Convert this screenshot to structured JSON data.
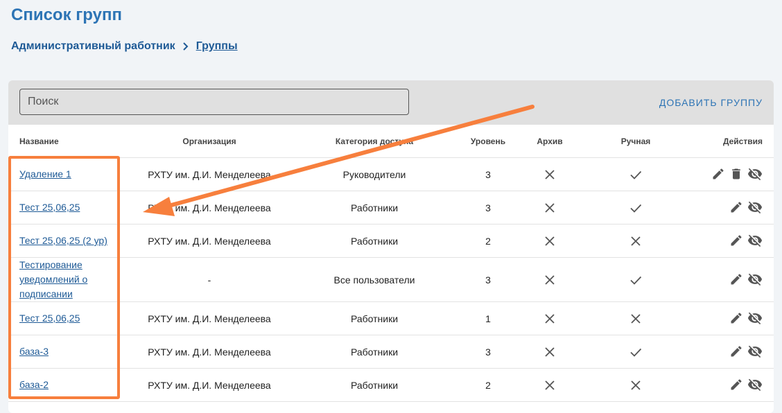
{
  "page": {
    "title": "Список групп"
  },
  "breadcrumb": {
    "parent": "Административный работник",
    "current": "Группы"
  },
  "toolbar": {
    "search_placeholder": "Поиск",
    "add_label": "ДОБАВИТЬ ГРУППУ"
  },
  "table": {
    "columns": {
      "name": "Название",
      "org": "Организация",
      "category": "Категория доступа",
      "level": "Уровень",
      "archive": "Архив",
      "manual": "Ручная",
      "actions": "Действия"
    },
    "rows": [
      {
        "name": "Удаление 1",
        "org": "РХТУ им. Д.И. Менделеева",
        "category": "Руководители",
        "level": "3",
        "archive": "x-icon",
        "manual": "check-icon",
        "actions": [
          "edit-icon",
          "delete-icon",
          "visibility-off-icon"
        ]
      },
      {
        "name": "Тест 25,06,25",
        "org": "РХТУ им. Д.И. Менделеева",
        "category": "Работники",
        "level": "3",
        "archive": "x-icon",
        "manual": "check-icon",
        "actions": [
          "edit-icon",
          "visibility-off-icon"
        ]
      },
      {
        "name": "Тест 25,06,25 (2 ур)",
        "org": "РХТУ им. Д.И. Менделеева",
        "category": "Работники",
        "level": "2",
        "archive": "x-icon",
        "manual": "x-icon",
        "actions": [
          "edit-icon",
          "visibility-off-icon"
        ]
      },
      {
        "name": "Тестирование уведомлений о подписании",
        "org": "-",
        "category": "Все пользователи",
        "level": "3",
        "archive": "x-icon",
        "manual": "check-icon",
        "actions": [
          "edit-icon",
          "visibility-off-icon"
        ]
      },
      {
        "name": "Тест 25,06,25",
        "org": "РХТУ им. Д.И. Менделеева",
        "category": "Работники",
        "level": "1",
        "archive": "x-icon",
        "manual": "x-icon",
        "actions": [
          "edit-icon",
          "visibility-off-icon"
        ]
      },
      {
        "name": "база-3",
        "org": "РХТУ им. Д.И. Менделеева",
        "category": "Работники",
        "level": "3",
        "archive": "x-icon",
        "manual": "check-icon",
        "actions": [
          "edit-icon",
          "visibility-off-icon"
        ]
      },
      {
        "name": "база-2",
        "org": "РХТУ им. Д.И. Менделеева",
        "category": "Работники",
        "level": "2",
        "archive": "x-icon",
        "manual": "x-icon",
        "actions": [
          "edit-icon",
          "visibility-off-icon"
        ]
      }
    ]
  },
  "annotation": {
    "color": "#f77f3d"
  }
}
